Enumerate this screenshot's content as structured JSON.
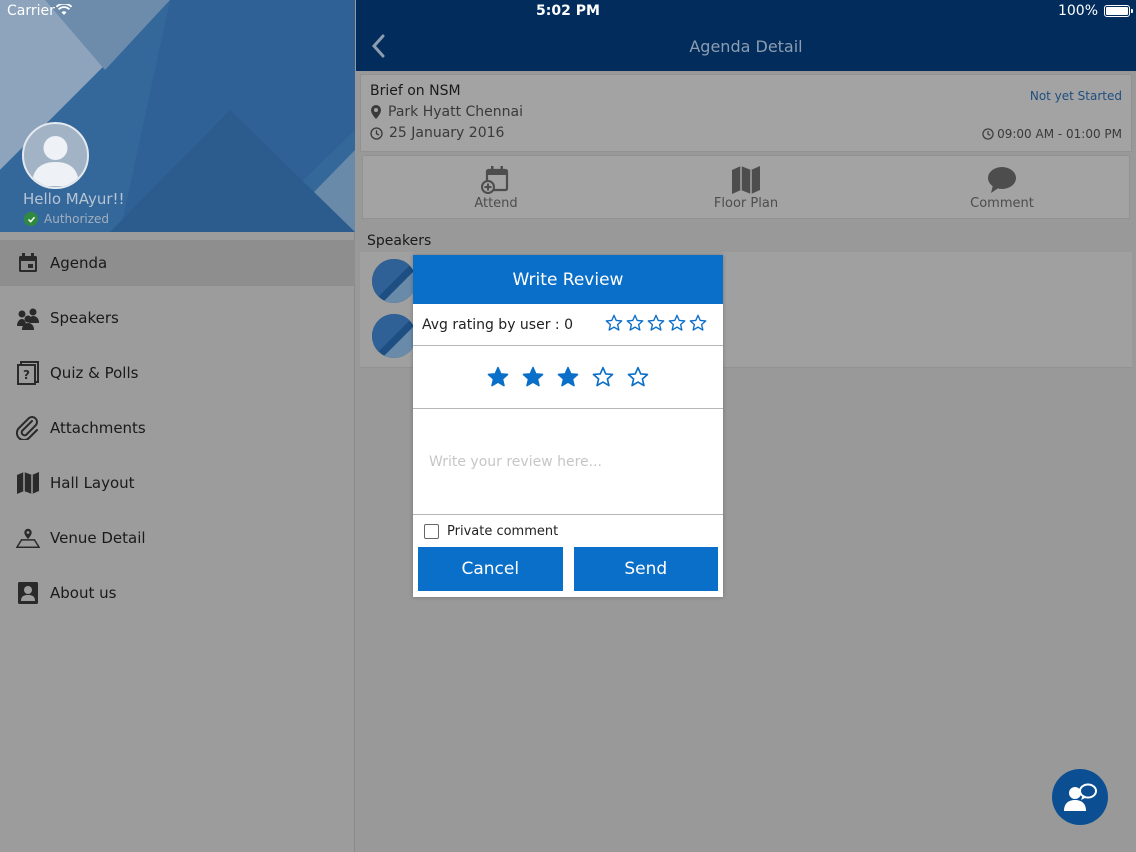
{
  "status_bar": {
    "carrier": "Carrier",
    "time": "5:02 PM",
    "battery": "100%"
  },
  "sidebar": {
    "greeting": "Hello MAyur!!",
    "auth_status": "Authorized",
    "items": [
      {
        "label": "Agenda",
        "icon": "calendar-icon",
        "active": true
      },
      {
        "label": "Speakers",
        "icon": "speakers-icon"
      },
      {
        "label": "Quiz & Polls",
        "icon": "quiz-icon"
      },
      {
        "label": "Attachments",
        "icon": "paperclip-icon"
      },
      {
        "label": "Hall Layout",
        "icon": "map-icon"
      },
      {
        "label": "Venue Detail",
        "icon": "venue-map-icon"
      },
      {
        "label": "About us",
        "icon": "contact-icon"
      }
    ]
  },
  "nav": {
    "title": "Agenda Detail"
  },
  "agenda": {
    "title": "Brief on NSM",
    "status": "Not yet Started",
    "venue": "Park Hyatt Chennai",
    "date": "25 January 2016",
    "time_range": "09:00 AM - 01:00 PM"
  },
  "actions": {
    "attend": "Attend",
    "floor_plan": "Floor Plan",
    "comment": "Comment"
  },
  "speakers_label": "Speakers",
  "review_modal": {
    "title": "Write Review",
    "avg_label": "Avg rating by user : 0",
    "avg_rating": 0,
    "user_rating": 3,
    "max_rating": 5,
    "placeholder": "Write your review here...",
    "private_label": "Private comment",
    "cancel_label": "Cancel",
    "send_label": "Send"
  },
  "colors": {
    "nav_bg": "#012c5c",
    "accent": "#0a6fc8",
    "star": "#0a6fc8"
  }
}
